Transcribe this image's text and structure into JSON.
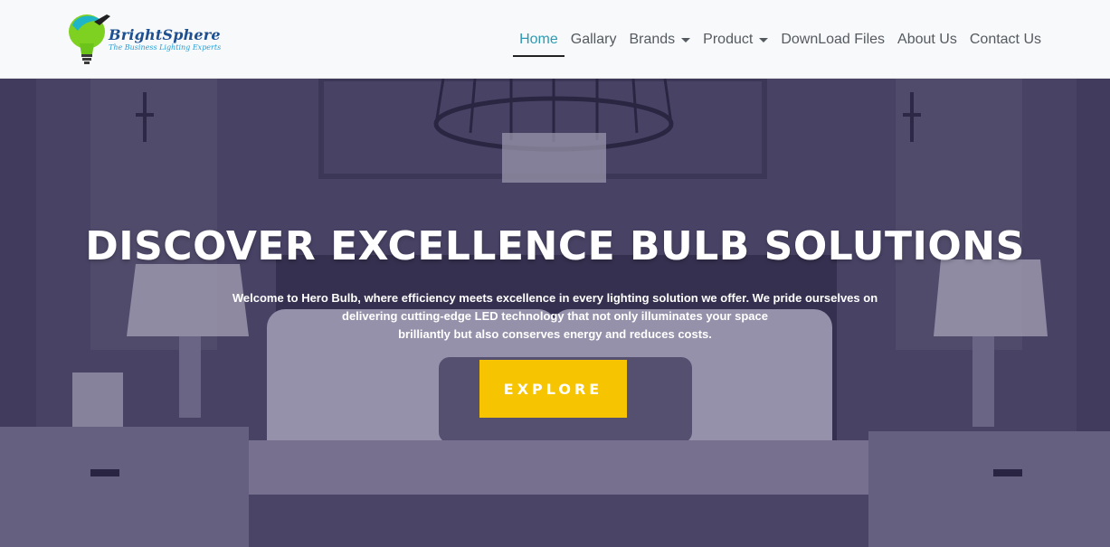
{
  "brand": {
    "name": "BrightSphere",
    "tagline": "The Business Lighting Experts",
    "colors": {
      "primary": "#1d4f91",
      "tagline": "#2a9fd6",
      "bulb_green": "#7fd121",
      "bulb_cyan": "#1fb5c9"
    }
  },
  "nav": {
    "items": [
      {
        "label": "Home",
        "active": true,
        "dropdown": false
      },
      {
        "label": "Gallary",
        "active": false,
        "dropdown": false
      },
      {
        "label": "Brands",
        "active": false,
        "dropdown": true
      },
      {
        "label": "Product",
        "active": false,
        "dropdown": true
      },
      {
        "label": "DownLoad Files",
        "active": false,
        "dropdown": false
      },
      {
        "label": "About Us",
        "active": false,
        "dropdown": false
      },
      {
        "label": "Contact Us",
        "active": false,
        "dropdown": false
      }
    ],
    "active_color": "#2d9ab3",
    "text_color": "#555a60",
    "caret_icon": "chevron-down-icon"
  },
  "hero": {
    "title": "DISCOVER EXCELLENCE BULB SOLUTIONS",
    "description_lines": [
      "Welcome to Hero Bulb, where efficiency meets excellence in every lighting solution we offer. We pride ourselves on",
      "delivering cutting-edge LED technology that not only illuminates your space",
      "brilliantly but also conserves energy and reduces costs."
    ],
    "cta_label": "EXPLORE",
    "cta_color": "#f6c400",
    "background": "bedroom-interior-image"
  }
}
